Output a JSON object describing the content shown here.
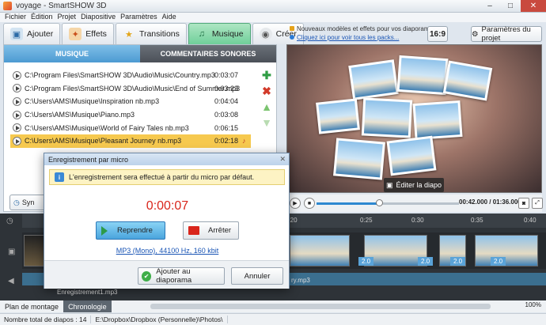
{
  "window": {
    "title": "voyage - SmartSHOW 3D"
  },
  "menu": [
    "Fichier",
    "Édition",
    "Projet",
    "Diapositive",
    "Paramètres",
    "Aide"
  ],
  "tabs": [
    {
      "label": "Ajouter",
      "icon": "add-icon"
    },
    {
      "label": "Effets",
      "icon": "effects-icon"
    },
    {
      "label": "Transitions",
      "icon": "transitions-icon"
    },
    {
      "label": "Musique",
      "icon": "music-icon",
      "active": true
    },
    {
      "label": "Créer",
      "icon": "create-icon"
    }
  ],
  "news": {
    "line1": "Nouveaux modèles et effets pour vos diaporamas",
    "line2": "Cliquez ici pour voir tous les packs..."
  },
  "toolbar": {
    "ratio_label": "16:9",
    "params_label": "Paramètres du projet"
  },
  "subtabs": {
    "music": "MUSIQUE",
    "voice": "COMMENTAIRES SONORES"
  },
  "tracks": [
    {
      "path": "C:\\Program Files\\SmartSHOW 3D\\Audio\\Music\\Country.mp3",
      "duration": "0:03:07"
    },
    {
      "path": "C:\\Program Files\\SmartSHOW 3D\\Audio\\Music\\End of Summer.mp3",
      "duration": "0:03:23"
    },
    {
      "path": "C:\\Users\\AMS\\Musique\\Inspiration nb.mp3",
      "duration": "0:04:04"
    },
    {
      "path": "C:\\Users\\AMS\\Musique\\Piano.mp3",
      "duration": "0:03:08"
    },
    {
      "path": "C:\\Users\\AMS\\Musique\\World of Fairy Tales nb.mp3",
      "duration": "0:06:15"
    },
    {
      "path": "C:\\Users\\AMS\\Musique\\Pleasant Journey nb.mp3",
      "duration": "0:02:18",
      "selected": true
    }
  ],
  "sync_label": "Syn",
  "preview": {
    "edit_label": "Éditer la diapo"
  },
  "player": {
    "time": "00:42.000 / 01:36.000"
  },
  "timeline": {
    "ticks": [
      "0:20",
      "0:25",
      "0:30",
      "0:35",
      "0:40"
    ],
    "badges": [
      "2.0",
      "2.0",
      "2.0",
      "2.0"
    ],
    "audio_label": "Enregistrement1.mp3",
    "audio_label2": "ry.mp3"
  },
  "bottom_tabs": {
    "storyboard": "Plan de montage",
    "timeline": "Chronologie"
  },
  "zoom": "100%",
  "status": {
    "count": "Nombre total de diapos : 14",
    "path": "E:\\Dropbox\\Dropbox (Personnelle)\\Photos\\"
  },
  "dialog": {
    "title": "Enregistrement par micro",
    "info": "L'enregistrement sera effectué à partir du micro par défaut.",
    "timer": "0:00:07",
    "resume_label": "Reprendre",
    "stop_label": "Arrêter",
    "format_link": "MP3 (Mono), 44100 Hz, 160 kbit",
    "add_label": "Ajouter au diaporama",
    "cancel_label": "Annuler"
  }
}
